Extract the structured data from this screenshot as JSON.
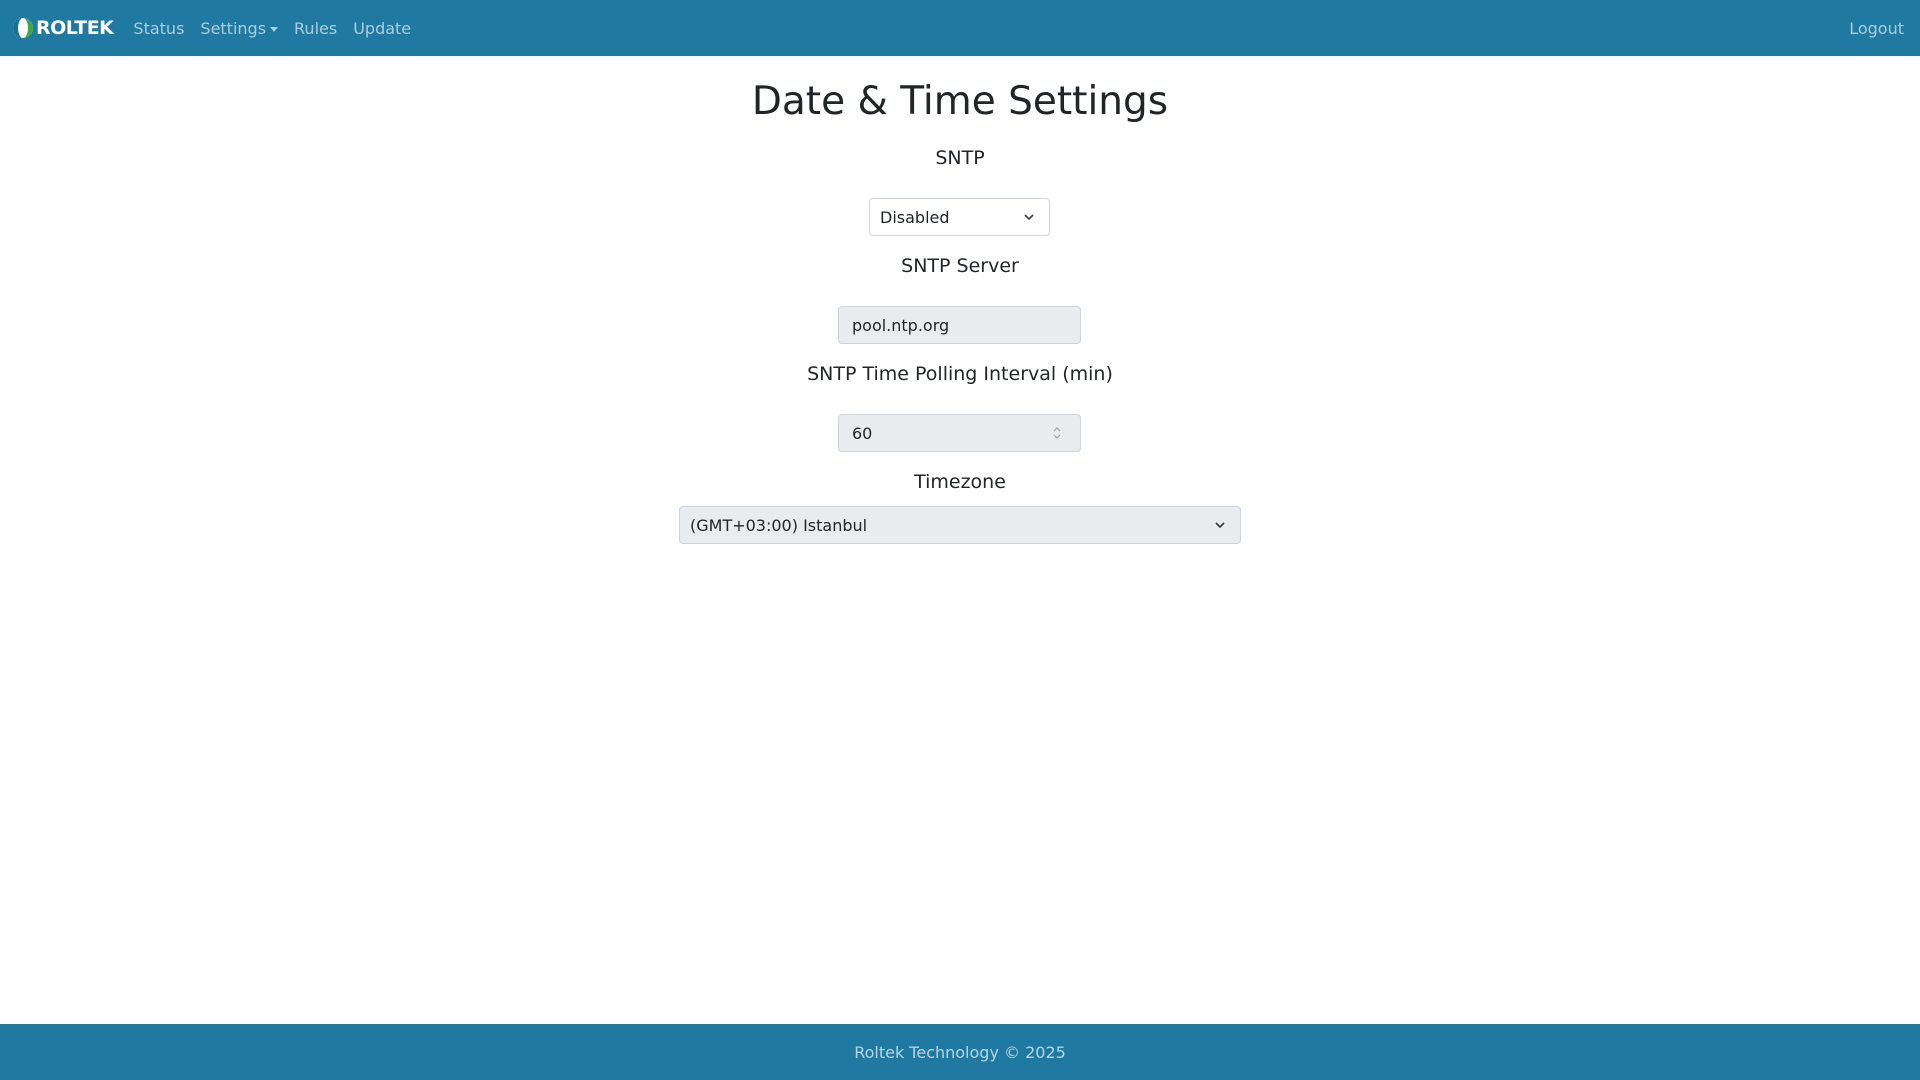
{
  "navbar": {
    "brand": "ROLTEK",
    "links": [
      {
        "label": "Status"
      },
      {
        "label": "Settings"
      },
      {
        "label": "Rules"
      },
      {
        "label": "Update"
      }
    ],
    "logout": "Logout",
    "color": "#2079a0"
  },
  "page": {
    "title": "Date & Time Settings"
  },
  "sntp": {
    "label": "SNTP",
    "value": "Disabled"
  },
  "sntp_server": {
    "label": "SNTP Server",
    "value": "pool.ntp.org"
  },
  "polling": {
    "label": "SNTP Time Polling Interval (min)",
    "value": "60"
  },
  "timezone": {
    "label": "Timezone",
    "value": "(GMT+03:00) Istanbul"
  },
  "footer": {
    "text": "Roltek Technology © 2025"
  }
}
